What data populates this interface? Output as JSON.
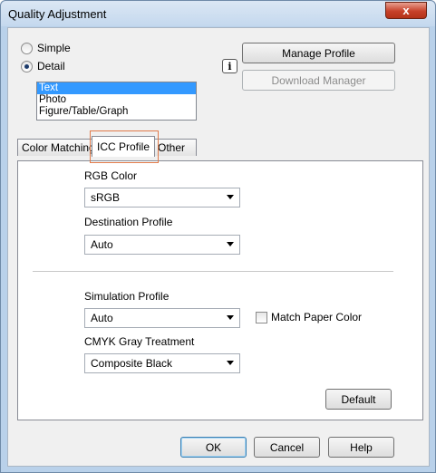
{
  "window": {
    "title": "Quality Adjustment",
    "close_glyph": "x"
  },
  "mode": {
    "simple_label": "Simple",
    "detail_label": "Detail",
    "selected": "Detail"
  },
  "object_list": {
    "items": [
      "Text",
      "Photo",
      "Figure/Table/Graph"
    ],
    "selected_index": 0
  },
  "buttons": {
    "manage_profile": "Manage Profile",
    "download_manager": "Download Manager",
    "info_glyph": "i"
  },
  "tabs": [
    {
      "label": "Color Matching"
    },
    {
      "label": "ICC Profile"
    },
    {
      "label": "Other"
    }
  ],
  "active_tab": "ICC Profile",
  "icc": {
    "rgb_color_label": "RGB Color",
    "rgb_color_value": "sRGB",
    "destination_label": "Destination Profile",
    "destination_value": "Auto",
    "simulation_label": "Simulation Profile",
    "simulation_value": "Auto",
    "match_paper_label": "Match Paper Color",
    "match_paper_checked": false,
    "cmyk_gray_label": "CMYK Gray Treatment",
    "cmyk_gray_value": "Composite Black",
    "default_button": "Default"
  },
  "footer": {
    "ok": "OK",
    "cancel": "Cancel",
    "help": "Help"
  },
  "colors": {
    "selection": "#3399ff",
    "tab_highlight": "#e07a4a",
    "title_bg": "#c4d8ee"
  }
}
